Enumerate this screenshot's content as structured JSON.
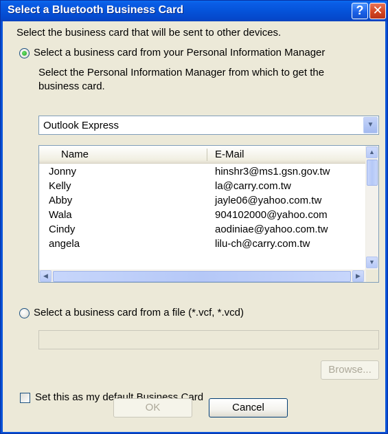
{
  "window": {
    "title": "Select a Bluetooth Business Card",
    "help_glyph": "?",
    "close_glyph": "✕"
  },
  "dialog": {
    "instruction": "Select the business card that will be sent to other devices.",
    "option_pim": {
      "label": "Select a business card from your Personal Information Manager",
      "selected": true
    },
    "pim_prompt_line1": "Select the Personal Information Manager from which to get the",
    "pim_prompt_line2": "business card.",
    "pim_select": {
      "value": "Outlook Express"
    },
    "contacts": {
      "columns": [
        "Name",
        "E-Mail"
      ],
      "rows": [
        {
          "name": "Jonny",
          "email": "hinshr3@ms1.gsn.gov.tw"
        },
        {
          "name": "Kelly",
          "email": "la@carry.com.tw"
        },
        {
          "name": "Abby",
          "email": "jayle06@yahoo.com.tw"
        },
        {
          "name": "Wala",
          "email": "904102000@yahoo.com"
        },
        {
          "name": "Cindy",
          "email": "aodiniae@yahoo.com.tw"
        },
        {
          "name": "angela",
          "email": "lilu-ch@carry.com.tw"
        }
      ]
    },
    "option_file": {
      "label": "Select a business card from a file (*.vcf, *.vcd)",
      "selected": false
    },
    "file_path": {
      "value": ""
    },
    "browse_label": "Browse...",
    "default_checkbox": {
      "label": "Set this as my default Business Card",
      "checked": false
    },
    "ok_label": "OK",
    "cancel_label": "Cancel"
  },
  "colors": {
    "titlebar": "#0553d9",
    "dialog_bg": "#ece9d8",
    "close_button": "#d2431e"
  }
}
